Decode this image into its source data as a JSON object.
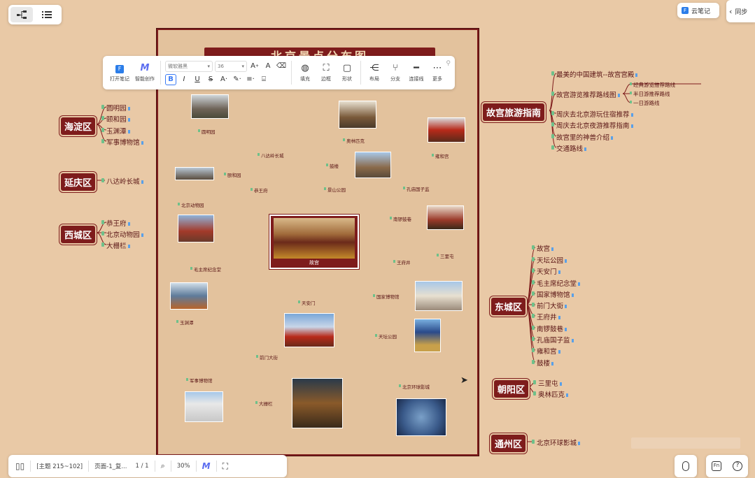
{
  "cloud_note": {
    "label": "云笔记"
  },
  "right_edge": {
    "label": "同步"
  },
  "poster": {
    "title": "北京景点分布图"
  },
  "toolbar": {
    "open_note": "打开笔记",
    "ai_create": "智能创作",
    "font_family": "微软雅黑",
    "font_size": "36",
    "fill": "填充",
    "border": "边框",
    "shape": "形状",
    "layout": "布局",
    "branch": "分支",
    "connector": "连接线",
    "more": "更多"
  },
  "bottom_bar": {
    "topic_count": "[主题 215~102]",
    "page_name": "页面-1_复...",
    "page_number": "1 / 1",
    "zoom": "30%"
  },
  "districts": [
    {
      "name": "海淀区",
      "items": [
        "圆明园",
        "颐和园",
        "玉渊潭",
        "军事博物馆"
      ]
    },
    {
      "name": "延庆区",
      "items": [
        "八达岭长城"
      ]
    },
    {
      "name": "西城区",
      "items": [
        "恭王府",
        "北京动物园",
        "大栅栏"
      ]
    },
    {
      "name": "东城区",
      "items": [
        "故宫",
        "天坛公园",
        "天安门",
        "毛主席纪念堂",
        "国家博物馆",
        "前门大街",
        "王府井",
        "南锣鼓巷",
        "孔庙国子监",
        "雍和宫",
        "鼓楼"
      ]
    },
    {
      "name": "朝阳区",
      "items": [
        "三里屯",
        "奥林匹克"
      ]
    },
    {
      "name": "通州区",
      "items": [
        "北京环球影城"
      ]
    }
  ],
  "guide": {
    "name": "故宫旅游指南",
    "items": [
      "最美的中国建筑--故宫宫殿",
      "故宫游览推荐路线图",
      "周庆去北京游玩住宿推荐",
      "周庆去北京夜游推荐指南",
      "故宫里的神兽介绍",
      "交通路线"
    ],
    "sub_items": [
      "经典游览推荐路线",
      "半日游推荐路线",
      "一日游路线"
    ]
  },
  "center": {
    "label": "故宫"
  },
  "poster_labels": [
    "圆明园",
    "八达岭长城",
    "颐和园",
    "恭王府",
    "北京动物园",
    "毛主席纪念堂",
    "玉渊潭",
    "军事博物馆",
    "天安门",
    "前门大街",
    "大栅栏",
    "奥林匹克",
    "鼓楼",
    "景山公园",
    "雍和宫",
    "孔庙国子监",
    "南锣鼓巷",
    "三里屯",
    "王府井",
    "国家博物馆",
    "天坛公园",
    "北京环球影城"
  ]
}
